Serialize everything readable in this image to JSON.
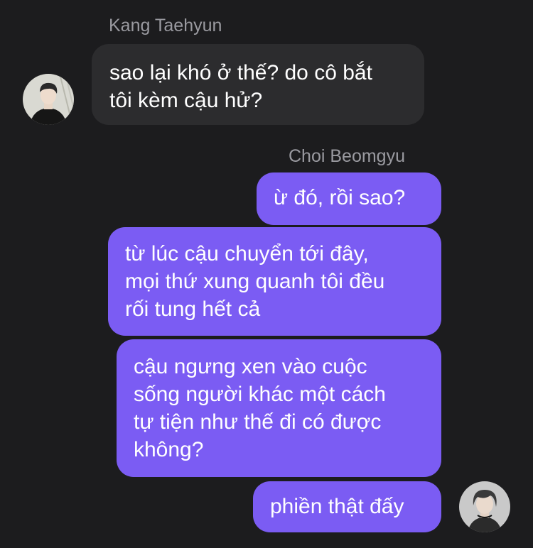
{
  "chat": {
    "incoming": {
      "sender_name": "Kang Taehyun",
      "messages": [
        {
          "lines": [
            "sao lại khó ở thế? do cô bắt",
            "tôi kèm cậu hử?"
          ]
        }
      ]
    },
    "outgoing": {
      "sender_name": "Choi Beomgyu",
      "messages": [
        {
          "lines": [
            "ừ đó, rồi sao?"
          ]
        },
        {
          "lines": [
            "từ lúc cậu chuyển tới đây,",
            "mọi thứ xung quanh tôi đều",
            "rối tung hết cả"
          ]
        },
        {
          "lines": [
            "cậu ngưng xen vào cuộc",
            "sống người khác một cách",
            "tự tiện như thế đi có được",
            "không?"
          ]
        },
        {
          "lines": [
            "phiền thật đấy"
          ]
        }
      ]
    }
  },
  "colors": {
    "background": "#1c1c1e",
    "incoming_bubble": "#2c2c2e",
    "outgoing_bubble": "#7b5cf3",
    "sender_name": "#9a9aa0"
  }
}
